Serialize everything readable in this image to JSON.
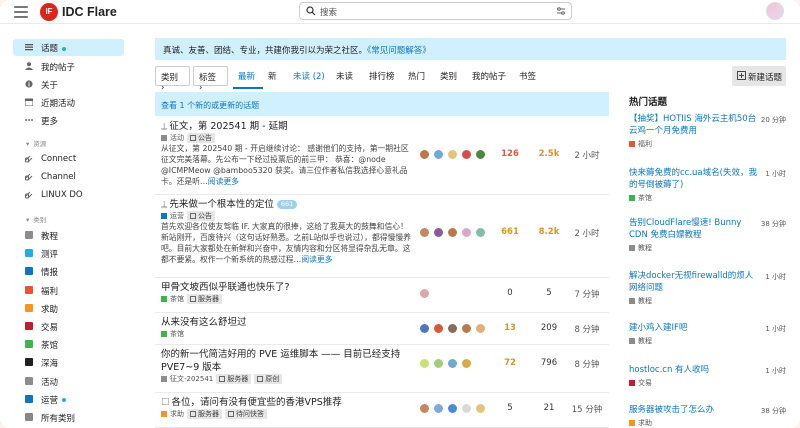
{
  "header": {
    "logo_badge": "IF",
    "logo_text": "IDC Flare",
    "search_placeholder": "搜索"
  },
  "sidebar": {
    "items": [
      {
        "label": "话题",
        "icon": "topics-icon",
        "active": true,
        "dot": true
      },
      {
        "label": "我的帖子",
        "icon": "user-icon"
      },
      {
        "label": "关于",
        "icon": "info-icon"
      },
      {
        "label": "近期活动",
        "icon": "activity-icon"
      },
      {
        "label": "更多",
        "icon": "more-icon"
      }
    ],
    "section_resources": "资源",
    "resources": [
      {
        "label": "Connect",
        "icon": "link-icon"
      },
      {
        "label": "Channel",
        "icon": "link-icon"
      },
      {
        "label": "LINUX DO",
        "icon": "link-icon"
      }
    ],
    "section_categories": "类别",
    "categories": [
      {
        "label": "教程",
        "color": "#8c8c8c"
      },
      {
        "label": "测评",
        "color": "#25aae2"
      },
      {
        "label": "情报",
        "color": "#0e76bd"
      },
      {
        "label": "福利",
        "color": "#e45735"
      },
      {
        "label": "求助",
        "color": "#f7941d"
      },
      {
        "label": "交易",
        "color": "#bf1e2e"
      },
      {
        "label": "茶馆",
        "color": "#3ab54a"
      },
      {
        "label": "深海",
        "color": "#231f20"
      },
      {
        "label": "活动",
        "color": "#8c8c8c"
      },
      {
        "label": "运营",
        "color": "#0e76bd",
        "dot": true
      },
      {
        "label": "所有类别",
        "color": "#888"
      }
    ]
  },
  "banner": {
    "text": "真诚、友善、团结、专业，共建你我引以为荣之社区。",
    "link": "《常见问题解答》"
  },
  "nav": {
    "category_dropdown": "类别",
    "tag_dropdown": "标签",
    "tabs": [
      {
        "label": "最新",
        "active": true
      },
      {
        "label": "新"
      },
      {
        "label": "未读 (2)",
        "unread": true
      },
      {
        "label": "未读"
      },
      {
        "label": "排行榜"
      },
      {
        "label": "热门"
      },
      {
        "label": "类别"
      },
      {
        "label": "我的帖子"
      },
      {
        "label": "书签"
      }
    ],
    "new_topic_label": "新建话题"
  },
  "new_topics_notice": "查看 1 个新的或更新的话题",
  "topics": [
    {
      "title": "征文，第 202541 期 - 延期",
      "pinned": true,
      "category": "活动",
      "category_color": "#8c8c8c",
      "tags": [
        "公告"
      ],
      "excerpt": "从征文，第 202540 期 - 开启继续讨论： 感谢他们的支持，第一期社区征文完美落幕。先公布一下经过投票后的前三甲： 恭喜：@node @ICMPMeow @bamboo5320 获奖。请三位作者私信我选择心意礼品卡。还是听…",
      "excerpt_link": "阅读更多",
      "replies": "126",
      "replies_hot": 1,
      "views": "2.5k",
      "views_hot": 2,
      "activity": "2 小时"
    },
    {
      "title": "先来做一个根本性的定位",
      "pinned": true,
      "badge": "661",
      "category": "运营",
      "category_color": "#0e76bd",
      "tags": [
        "公告"
      ],
      "excerpt": "首先欢迎各位使友驾临 IF. 大家真的很捧，这给了我莫大的鼓舞和信心！新站刚开，百废待兴（这句话好熟悉。之前L站似乎也说过），都得慢慢养吧。目前大家都处在新鲜和兴奋中，友情内容和分区将显得杂乱无章。这都不要紧。权作一个新系统的热感过程…",
      "excerpt_link": "阅读更多",
      "replies": "661",
      "replies_hot": 2,
      "views": "8.2k",
      "views_hot": 2,
      "activity": "2 小时"
    },
    {
      "title": "甲骨文坡西似乎联通也快乐了?",
      "category": "茶馆",
      "category_color": "#3ab54a",
      "tags": [
        "服务器"
      ],
      "replies": "0",
      "views": "5",
      "activity": "7 分钟"
    },
    {
      "title": "从来没有这么舒坦过",
      "category": "茶馆",
      "category_color": "#3ab54a",
      "tags": [],
      "replies": "13",
      "replies_hot": 2,
      "views": "209",
      "activity": "8 分钟"
    },
    {
      "title": "你的新一代简洁好用的 PVE 运维脚本 —— 目前已经支持 PVE7~9 版本",
      "category": "征文-202541",
      "category_color": "#8c8c8c",
      "tags": [
        "服务器",
        "原创"
      ],
      "replies": "72",
      "replies_hot": 2,
      "views": "796",
      "activity": "8 分钟"
    },
    {
      "title": "各位，请问有没有便宜些的香港VPS推荐",
      "checkbox": true,
      "category": "求助",
      "category_color": "#f7941d",
      "tags": [
        "服务器",
        "待问快答"
      ],
      "replies": "5",
      "views": "21",
      "activity": "15 分钟"
    }
  ],
  "hot_topics": {
    "title": "热门话题",
    "items": [
      {
        "title": "【抽奖】HOTIIS 海外云主机50台云鸡一个月免费用",
        "category": "福利",
        "color": "#e45735",
        "time": "20 分钟"
      },
      {
        "title": "快来薅免费的cc.ua域名(失效，我的号倒被薅了)",
        "category": "茶馆",
        "color": "#3ab54a",
        "time": "1 小时"
      },
      {
        "title": "告别CloudFlare慢速! Bunny CDN 免费白嫖教程",
        "category": "教程",
        "color": "#8c8c8c",
        "time": "38 分钟"
      },
      {
        "title": "解决docker无视firewalld的烦人网络问题",
        "category": "教程",
        "color": "#8c8c8c",
        "time": "1 小时"
      },
      {
        "title": "建小鸡入建IF吧",
        "category": "教程",
        "color": "#8c8c8c",
        "time": "1 小时"
      },
      {
        "title": "hostloc.cn 有人收吗",
        "category": "交易",
        "color": "#bf1e2e",
        "time": "1 小时"
      },
      {
        "title": "服务器被攻击了怎么办",
        "category": "求助",
        "color": "#f7941d",
        "time": "38 分钟"
      }
    ]
  }
}
